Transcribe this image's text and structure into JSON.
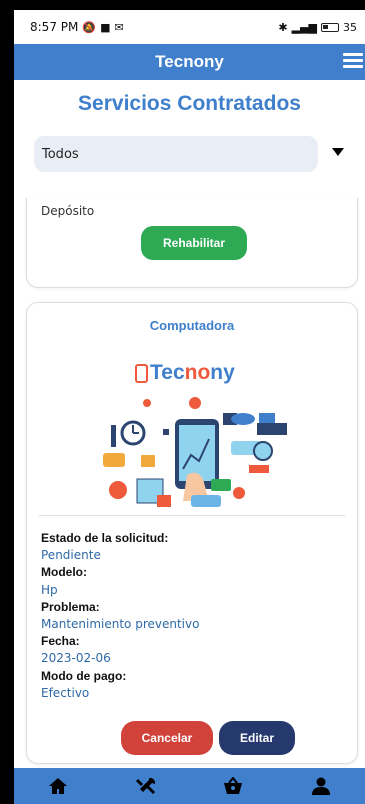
{
  "status_bar": {
    "time": "8:57 PM",
    "battery": "35"
  },
  "app": {
    "title": "Tecnony"
  },
  "page": {
    "title": "Servicios Contratados"
  },
  "filter": {
    "value": "Todos"
  },
  "card_prev": {
    "payment_value": "Depósito",
    "button": "Rehabilitar"
  },
  "card": {
    "category": "Computadora",
    "logo": {
      "part1": "Tec",
      "part2": "no",
      "part3": "ny"
    },
    "fields": [
      {
        "label": "Estado de la solicitud:",
        "value": "Pendiente"
      },
      {
        "label": "Modelo:",
        "value": "Hp"
      },
      {
        "label": "Problema:",
        "value": "Mantenimiento preventivo"
      },
      {
        "label": "Fecha:",
        "value": "2023-02-06"
      },
      {
        "label": "Modo de pago:",
        "value": "Efectivo"
      }
    ],
    "cancel_label": "Cancelar",
    "edit_label": "Editar"
  },
  "nav": [
    "home-icon",
    "tools-icon",
    "basket-icon",
    "user-icon"
  ],
  "colors": {
    "primary": "#3f7fcb",
    "green": "#2eaa55",
    "red": "#d1433a",
    "navy": "#26396e",
    "accent": "#ee5a3b"
  }
}
